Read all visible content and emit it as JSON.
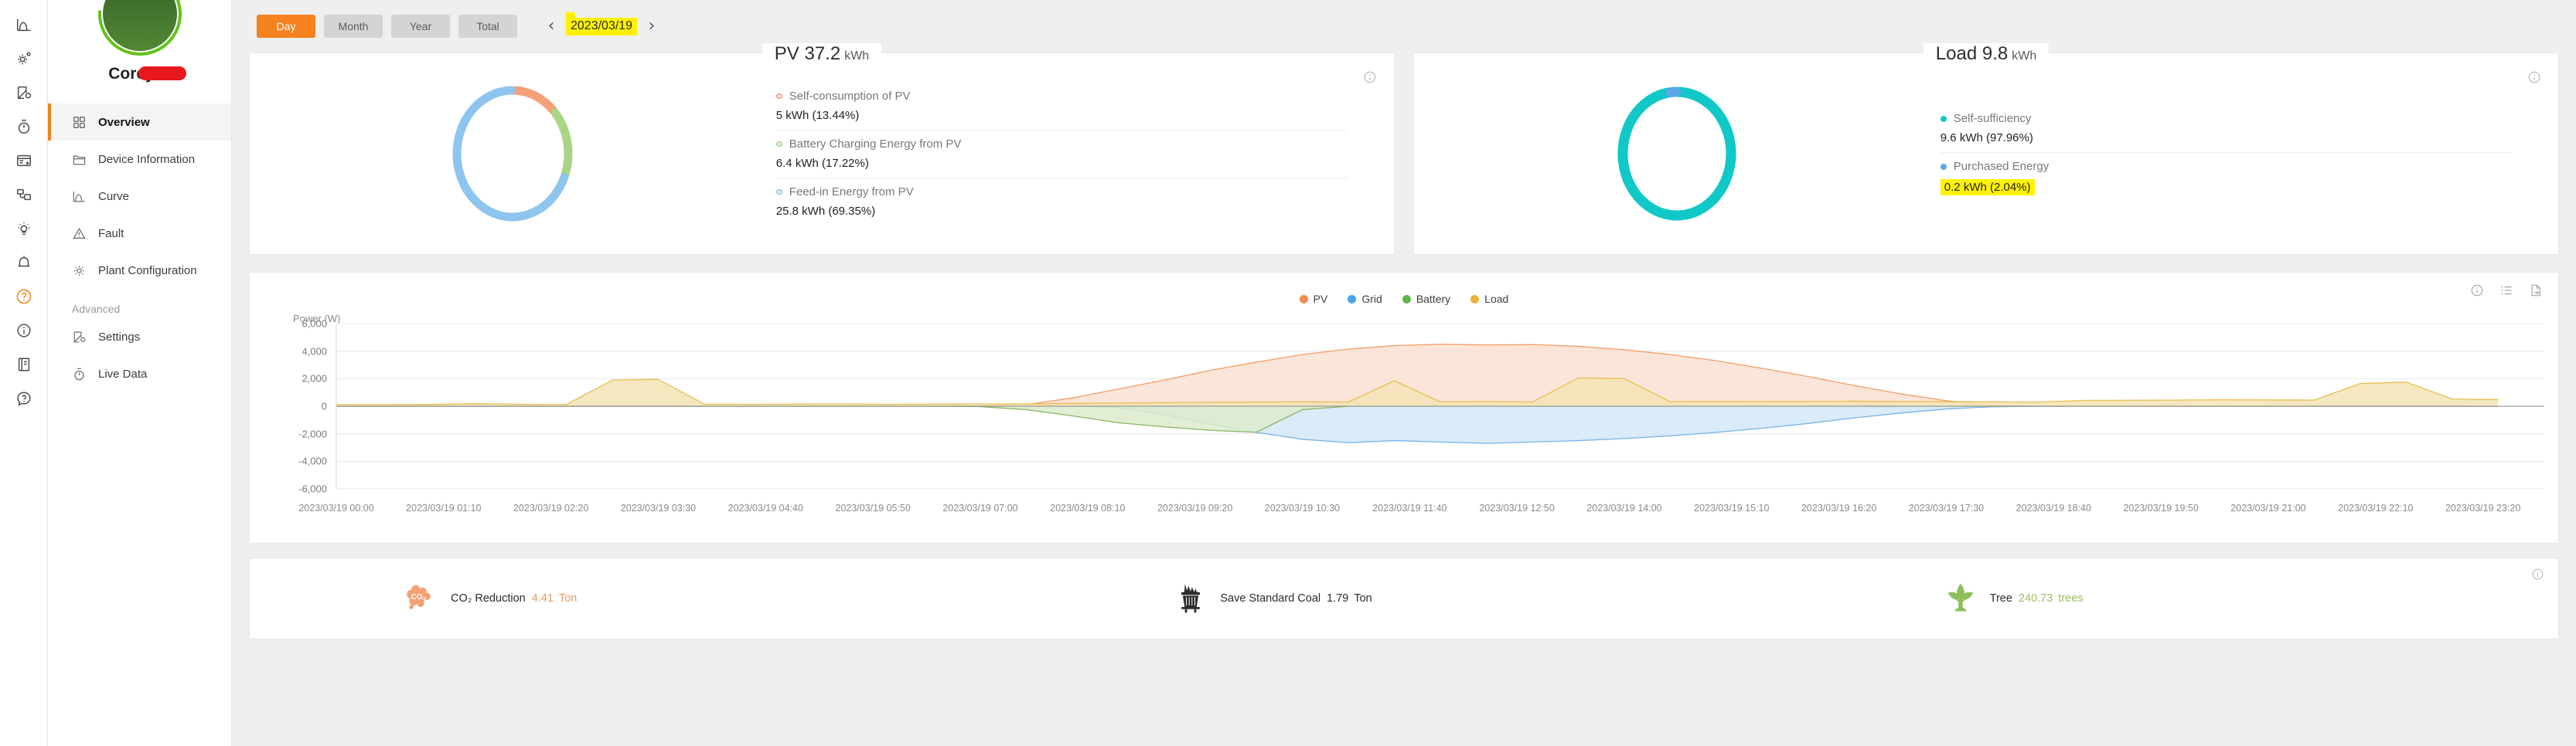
{
  "rail": {
    "items": [
      {
        "name": "curve-icon",
        "label": "Curve"
      },
      {
        "name": "settings-gear-icon",
        "label": "Settings"
      },
      {
        "name": "device-config-icon",
        "label": "Device Configuration"
      },
      {
        "name": "timer-icon",
        "label": "Live Data"
      },
      {
        "name": "report-alert-icon",
        "label": "Reports"
      },
      {
        "name": "devices-icon",
        "label": "Devices"
      },
      {
        "name": "lightbulb-icon",
        "label": "Tips"
      },
      {
        "name": "bell-icon",
        "label": "Notifications"
      },
      {
        "name": "help-circle-icon",
        "label": "Help",
        "active": true
      },
      {
        "name": "info-circle-icon",
        "label": "Info"
      },
      {
        "name": "document-icon",
        "label": "Documents"
      },
      {
        "name": "question-bubble-icon",
        "label": "Support"
      }
    ]
  },
  "sidebar": {
    "profile_name": "Corey R",
    "status_badge": "check-icon",
    "items": [
      {
        "label": "Overview",
        "icon": "grid-icon",
        "active": true
      },
      {
        "label": "Device Information",
        "icon": "folder-icon",
        "active": false
      },
      {
        "label": "Curve",
        "icon": "curve-icon",
        "active": false
      },
      {
        "label": "Fault",
        "icon": "warning-triangle-icon",
        "active": false
      },
      {
        "label": "Plant Configuration",
        "icon": "gear-icon",
        "active": false
      }
    ],
    "group_label": "Advanced",
    "advanced_items": [
      {
        "label": "Settings",
        "icon": "settings-edit-icon",
        "active": false
      },
      {
        "label": "Live Data",
        "icon": "timer-icon",
        "active": false
      }
    ]
  },
  "toolbar": {
    "ranges": [
      {
        "label": "Day",
        "active": true
      },
      {
        "label": "Month",
        "active": false
      },
      {
        "label": "Year",
        "active": false
      },
      {
        "label": "Total",
        "active": false
      }
    ],
    "prev_label": "‹",
    "next_label": "›",
    "date": "2023/03/19",
    "date_highlighted": true,
    "highlight_color": "#fff200",
    "accent_color": "#f5821f"
  },
  "pv_card": {
    "title": "PV 37.2",
    "unit": "kWh",
    "info_icon": "info-circle-icon",
    "donut": [
      {
        "label": "Self-consumption of PV",
        "value": "5 kWh (13.44%)",
        "percent": 13.44,
        "color": "#f5a07a"
      },
      {
        "label": "Battery Charging Energy from PV",
        "value": "6.4 kWh (17.22%)",
        "percent": 17.22,
        "color": "#a9d585"
      },
      {
        "label": "Feed-in Energy from PV",
        "value": "25.8 kWh (69.35%)",
        "percent": 69.35,
        "color": "#8ec5ef"
      }
    ]
  },
  "load_card": {
    "title": "Load 9.8",
    "unit": "kWh",
    "info_icon": "info-circle-icon",
    "donut": [
      {
        "label": "Self-sufficiency",
        "value": "9.6 kWh (97.96%)",
        "percent": 97.96,
        "color": "#10c8c8",
        "highlight": false
      },
      {
        "label": "Purchased Energy",
        "value": "0.2 kWh (2.04%)",
        "percent": 2.04,
        "color": "#5aa9e6",
        "highlight": true
      }
    ]
  },
  "chart_panel": {
    "tools": [
      "info-circle-icon",
      "list-icon",
      "export-icon"
    ]
  },
  "chart_data": {
    "type": "area",
    "title": "",
    "xlabel": "",
    "ylabel": "Power (W)",
    "ylim": [
      -6000,
      6000
    ],
    "yticks": [
      "6,000",
      "4,000",
      "2,000",
      "0",
      "-2,000",
      "-4,000",
      "-6,000"
    ],
    "ytick_values": [
      6000,
      4000,
      2000,
      0,
      -2000,
      -4000,
      -6000
    ],
    "grid": true,
    "legend_position": "top-center",
    "x_tick_labels": [
      "2023/03/19 00:00",
      "2023/03/19 01:10",
      "2023/03/19 02:20",
      "2023/03/19 03:30",
      "2023/03/19 04:40",
      "2023/03/19 05:50",
      "2023/03/19 07:00",
      "2023/03/19 08:10",
      "2023/03/19 09:20",
      "2023/03/19 10:30",
      "2023/03/19 11:40",
      "2023/03/19 12:50",
      "2023/03/19 14:00",
      "2023/03/19 15:10",
      "2023/03/19 16:20",
      "2023/03/19 17:30",
      "2023/03/19 18:40",
      "2023/03/19 19:50",
      "2023/03/19 21:00",
      "2023/03/19 22:10",
      "2023/03/19 23:20"
    ],
    "x": [
      0,
      0.5,
      1,
      1.5,
      2,
      2.5,
      3,
      3.5,
      4,
      4.5,
      5,
      5.5,
      6,
      6.5,
      7,
      7.5,
      8,
      8.5,
      9,
      9.5,
      10,
      10.5,
      11,
      11.5,
      12,
      12.5,
      13,
      13.5,
      14,
      14.5,
      15,
      15.5,
      16,
      16.5,
      17,
      17.5,
      18,
      18.5,
      19,
      19.5,
      20,
      20.5,
      21,
      21.5,
      22,
      22.5,
      23,
      23.5
    ],
    "series": [
      {
        "name": "PV",
        "color": "#f08d4f",
        "fill": "#fae0d2",
        "values": [
          0,
          0,
          0,
          0,
          0,
          0,
          0,
          0,
          0,
          0,
          0,
          0,
          0,
          0,
          30,
          120,
          600,
          1250,
          1900,
          2600,
          3200,
          3750,
          4150,
          4400,
          4500,
          4450,
          4480,
          4350,
          4100,
          3750,
          3300,
          2750,
          2150,
          1500,
          900,
          400,
          90,
          0,
          0,
          0,
          0,
          0,
          0,
          0,
          0,
          0,
          0,
          0
        ]
      },
      {
        "name": "Grid",
        "color": "#62a8e0",
        "fill": "#d3e8f8",
        "values": [
          0,
          0,
          0,
          0,
          0,
          0,
          0,
          0,
          0,
          0,
          0,
          0,
          0,
          0,
          0,
          0,
          0,
          -80,
          -600,
          -1300,
          -1900,
          -2400,
          -2650,
          -2500,
          -2600,
          -2700,
          -2600,
          -2500,
          -2350,
          -2150,
          -1900,
          -1600,
          -1250,
          -850,
          -500,
          -200,
          -40,
          0,
          0,
          0,
          0,
          0,
          0,
          0,
          0,
          0,
          0,
          0
        ]
      },
      {
        "name": "Battery",
        "color": "#7aaa4b",
        "fill": "#dcebcb",
        "values": [
          0,
          0,
          0,
          0,
          0,
          0,
          0,
          0,
          0,
          0,
          0,
          0,
          0,
          0,
          -30,
          -250,
          -700,
          -1200,
          -1500,
          -1750,
          -1900,
          -250,
          0,
          0,
          0,
          0,
          0,
          0,
          0,
          0,
          0,
          0,
          0,
          0,
          0,
          0,
          0,
          0,
          0,
          0,
          0,
          0,
          0,
          0,
          0,
          0,
          0,
          0
        ]
      },
      {
        "name": "Load",
        "color": "#e8b33c",
        "fill": "#f3e4b5",
        "values": [
          120,
          110,
          130,
          180,
          140,
          120,
          1900,
          1950,
          150,
          140,
          150,
          160,
          140,
          150,
          160,
          170,
          200,
          230,
          260,
          280,
          300,
          320,
          300,
          1850,
          310,
          330,
          300,
          2050,
          2000,
          330,
          340,
          330,
          350,
          360,
          340,
          330,
          320,
          300,
          420,
          430,
          450,
          470,
          460,
          450,
          1650,
          1750,
          520,
          480
        ]
      }
    ]
  },
  "stats": {
    "info_icon": "info-circle-icon",
    "items": [
      {
        "icon": "co2-cloud-icon",
        "label": "CO₂ Reduction",
        "value": "4.41",
        "unit": "Ton",
        "value_color": "#f0945c",
        "unit_color": "#f0945c"
      },
      {
        "icon": "coal-icon",
        "label": "Save Standard Coal",
        "value": "1.79",
        "unit": "Ton",
        "value_color": "#2b2b2b",
        "unit_color": "#2b2b2b"
      },
      {
        "icon": "tree-icon",
        "label": "Tree",
        "value": "240.73",
        "unit": "trees",
        "value_color": "#97bf63",
        "unit_color": "#97bf63"
      }
    ]
  }
}
